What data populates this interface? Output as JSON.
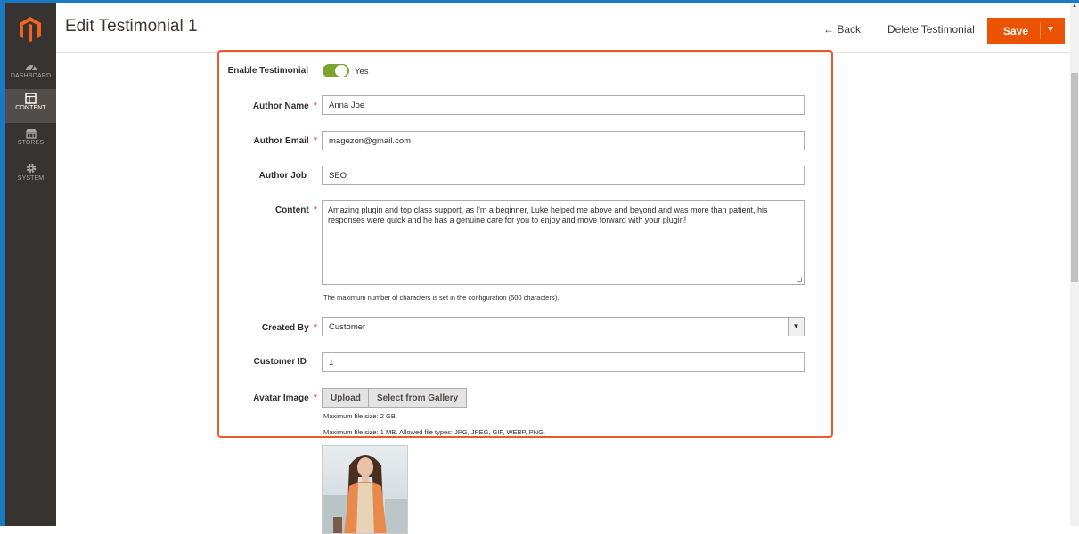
{
  "header": {
    "title": "Edit Testimonial 1",
    "back_label": "← Back",
    "delete_label": "Delete Testimonial",
    "save_label": "Save"
  },
  "sidebar": {
    "items": [
      {
        "label": "DASHBOARD",
        "icon": "dashboard-icon"
      },
      {
        "label": "CONTENT",
        "icon": "content-icon"
      },
      {
        "label": "STORES",
        "icon": "stores-icon"
      },
      {
        "label": "SYSTEM",
        "icon": "system-icon"
      }
    ]
  },
  "form": {
    "enable": {
      "label": "Enable Testimonial",
      "value": "Yes"
    },
    "author_name": {
      "label": "Author Name",
      "value": "Anna Joe"
    },
    "author_email": {
      "label": "Author Email",
      "value": "magezon@gmail.com"
    },
    "author_job": {
      "label": "Author Job",
      "value": "SEO"
    },
    "content": {
      "label": "Content",
      "value": "Amazing plugin and top class support, as I'm a beginner, Luke helped me above and beyond and was more than patient, his responses were quick and he has a genuine care for you to enjoy and move forward with your plugin!",
      "note": "The maximum number of characters is set in the configuration (500 characters)."
    },
    "created_by": {
      "label": "Created By",
      "value": "Customer"
    },
    "customer_id": {
      "label": "Customer ID",
      "value": "1"
    },
    "avatar": {
      "label": "Avatar Image",
      "upload_label": "Upload",
      "gallery_label": "Select from Gallery",
      "note1": "Maximum file size: 2 GB.",
      "note2": "Maximum file size: 1 MB. Allowed file types: JPG, JPEG, GIF, WEBP, PNG."
    },
    "required_mark": "*"
  },
  "colors": {
    "accent": "#eb5202",
    "highlight": "#e85a2a",
    "sidebar": "#373330",
    "toggle_on": "#79a22e"
  }
}
